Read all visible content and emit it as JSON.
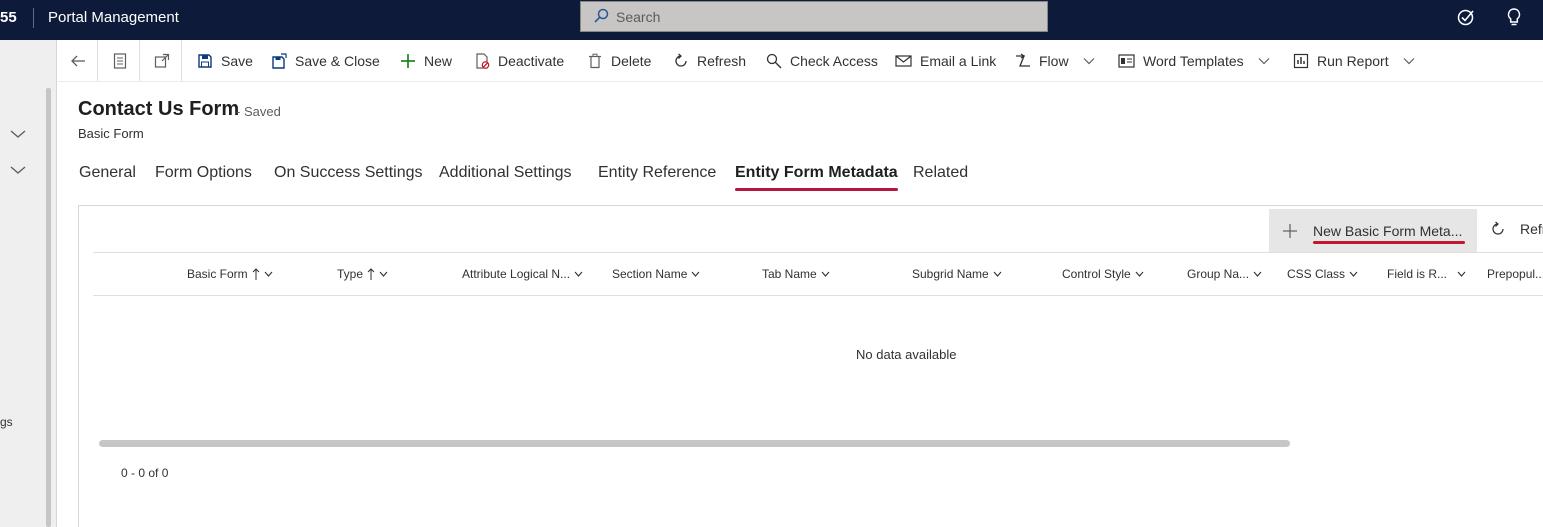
{
  "topbar": {
    "brand_fragment": "55",
    "app_title": "Portal Management",
    "search_placeholder": "Search"
  },
  "leftnav": {
    "cut_text": "gs"
  },
  "commands": {
    "save": "Save",
    "save_close": "Save & Close",
    "new": "New",
    "deactivate": "Deactivate",
    "delete": "Delete",
    "refresh": "Refresh",
    "check_access": "Check Access",
    "email_link": "Email a Link",
    "flow": "Flow",
    "word_templates": "Word Templates",
    "run_report": "Run Report"
  },
  "header": {
    "title": "Contact Us Form",
    "status": "- Saved",
    "entity_type": "Basic Form"
  },
  "tabs": [
    {
      "label": "General"
    },
    {
      "label": "Form Options"
    },
    {
      "label": "On Success Settings"
    },
    {
      "label": "Additional Settings"
    },
    {
      "label": "Entity Reference"
    },
    {
      "label": "Entity Form Metadata"
    },
    {
      "label": "Related"
    }
  ],
  "subgrid": {
    "new_button": "New Basic Form Meta...",
    "refresh_button": "Refr",
    "columns": [
      {
        "label": "Basic Form"
      },
      {
        "label": "Type"
      },
      {
        "label": "Attribute Logical N..."
      },
      {
        "label": "Section Name"
      },
      {
        "label": "Tab Name"
      },
      {
        "label": "Subgrid Name"
      },
      {
        "label": "Control Style"
      },
      {
        "label": "Group Na..."
      },
      {
        "label": "CSS Class"
      },
      {
        "label": "Field is R..."
      },
      {
        "label": "Prepopul..."
      }
    ],
    "empty_message": "No data available",
    "pager": "0 - 0 of 0"
  },
  "colors": {
    "topbar": "#0d1a3a",
    "accent": "#b3173d"
  }
}
